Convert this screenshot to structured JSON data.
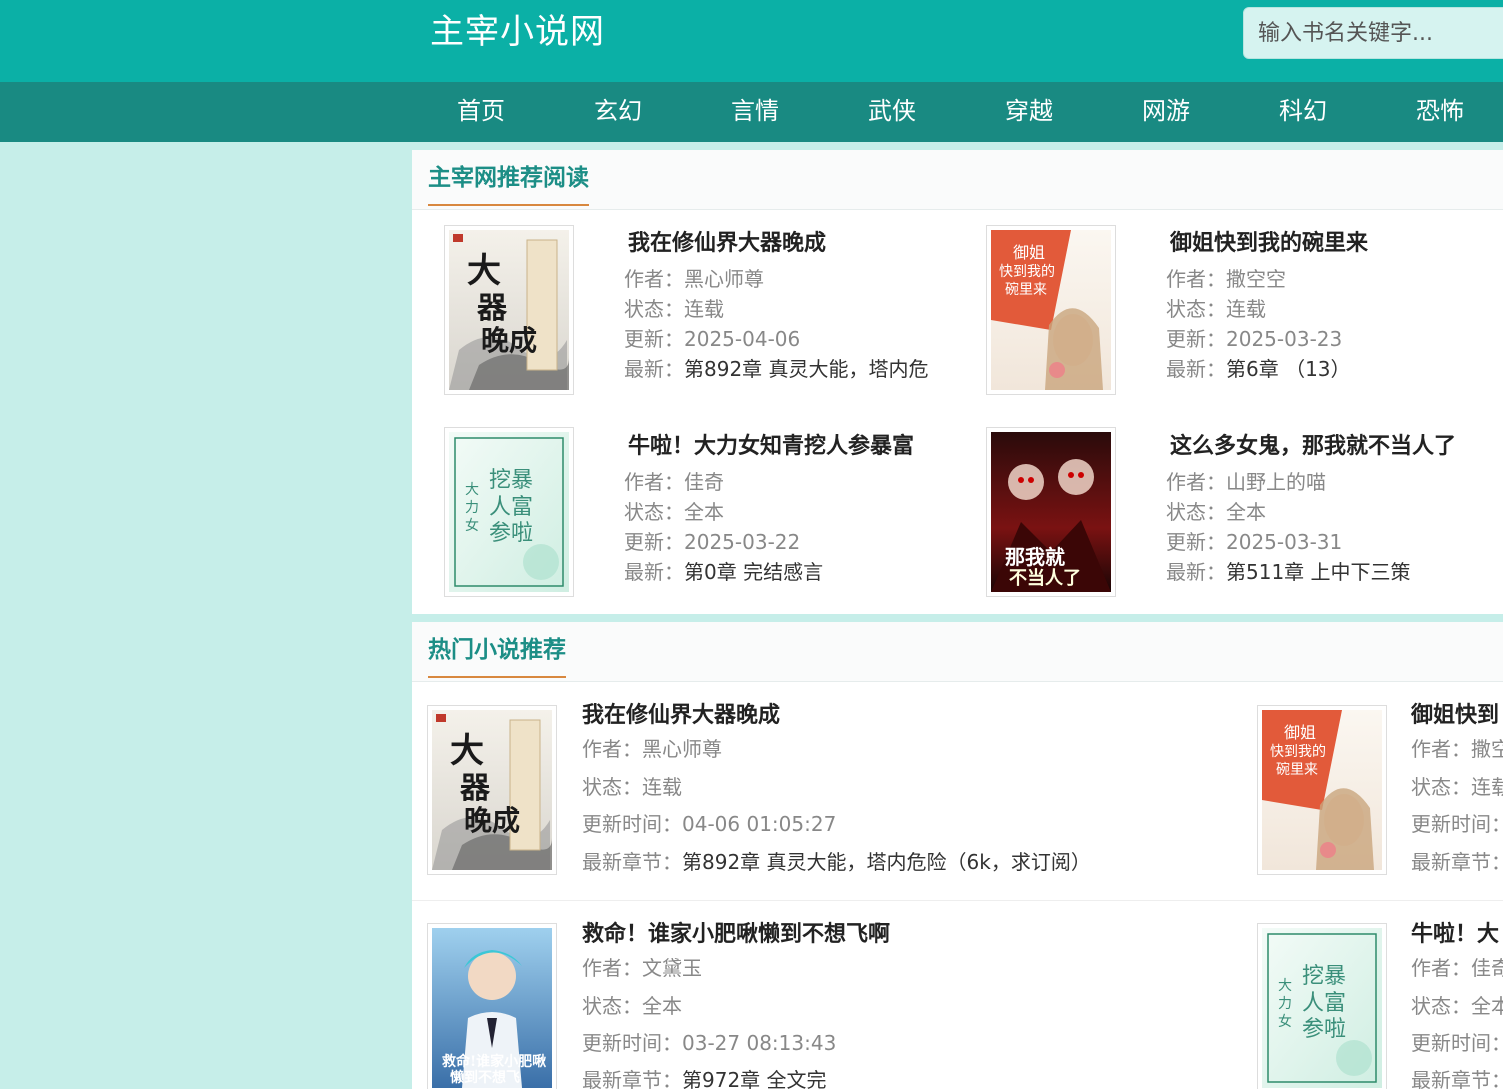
{
  "header": {
    "title": "主宰小说网",
    "search_placeholder": "输入书名关键字..."
  },
  "nav": [
    "首页",
    "玄幻",
    "言情",
    "武侠",
    "穿越",
    "网游",
    "科幻",
    "恐怖"
  ],
  "colors": {
    "header": "#0bb0a6",
    "nav": "#198a82",
    "background": "#c6eee9",
    "accent_title": "#1c8e86",
    "underline": "#d8883f"
  },
  "recommend": {
    "title": "主宰网推荐阅读",
    "labels": {
      "author": "作者：",
      "status": "状态：",
      "update": "更新：",
      "latest": "最新："
    },
    "books": [
      {
        "title": "我在修仙界大器晚成",
        "author": "黑心师尊",
        "status": "连载",
        "update": "2025-04-06",
        "latest": "第892章 真灵大能，塔内危",
        "cover": "xianjie"
      },
      {
        "title": "御姐快到我的碗里来",
        "author": "撒空空",
        "status": "连载",
        "update": "2025-03-23",
        "latest": "第6章 （13）",
        "cover": "yujie"
      },
      {
        "title": "牛啦！大力女知青挖人参暴富",
        "author": "佳奇",
        "status": "全本",
        "update": "2025-03-22",
        "latest": "第0章 完结感言",
        "cover": "zhiqing"
      },
      {
        "title": "这么多女鬼，那我就不当人了",
        "author": "山野上的喵",
        "status": "全本",
        "update": "2025-03-31",
        "latest": "第511章 上中下三策",
        "cover": "nvgui"
      }
    ]
  },
  "hot": {
    "title": "热门小说推荐",
    "labels": {
      "author": "作者：",
      "status": "状态：",
      "update": "更新时间：",
      "latest": "最新章节："
    },
    "books": [
      {
        "title": "我在修仙界大器晚成",
        "author": "黑心师尊",
        "status": "连载",
        "update": "04-06 01:05:27",
        "latest": "第892章 真灵大能，塔内危险（6k，求订阅）",
        "cover": "xianjie"
      },
      {
        "title": "御姐快到",
        "author": "撒空",
        "status": "连载",
        "update": "",
        "latest": "",
        "cover": "yujie"
      },
      {
        "title": "救命！谁家小肥啾懒到不想飞啊",
        "author": "文黛玉",
        "status": "全本",
        "update": "03-27 08:13:43",
        "latest": "第972章 全文完",
        "cover": "feijiu"
      },
      {
        "title": "牛啦！大",
        "author": "佳奇",
        "status": "全本",
        "update": "",
        "latest": "",
        "cover": "zhiqing"
      }
    ]
  }
}
